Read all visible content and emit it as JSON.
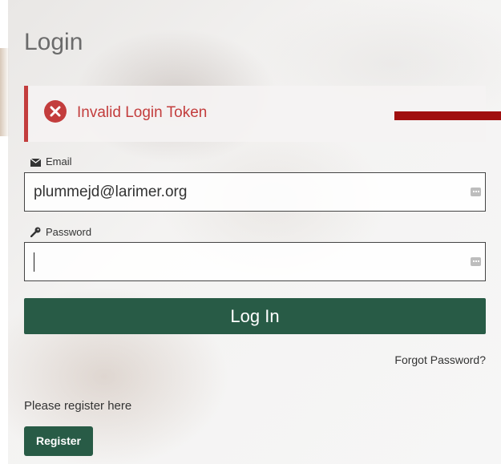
{
  "page": {
    "title": "Login"
  },
  "alert": {
    "message": "Invalid Login Token",
    "icon": "error-circle-icon",
    "color": "#c33d3d"
  },
  "email": {
    "label": "Email",
    "value": "plummejd@larimer.org",
    "icon": "envelope-icon"
  },
  "password": {
    "label": "Password",
    "value": "",
    "icon": "key-icon"
  },
  "actions": {
    "login_label": "Log In",
    "forgot_label": "Forgot Password?",
    "register_prompt": "Please register here",
    "register_label": "Register"
  },
  "colors": {
    "primary": "#285b46",
    "annotation": "#a00f0f"
  }
}
